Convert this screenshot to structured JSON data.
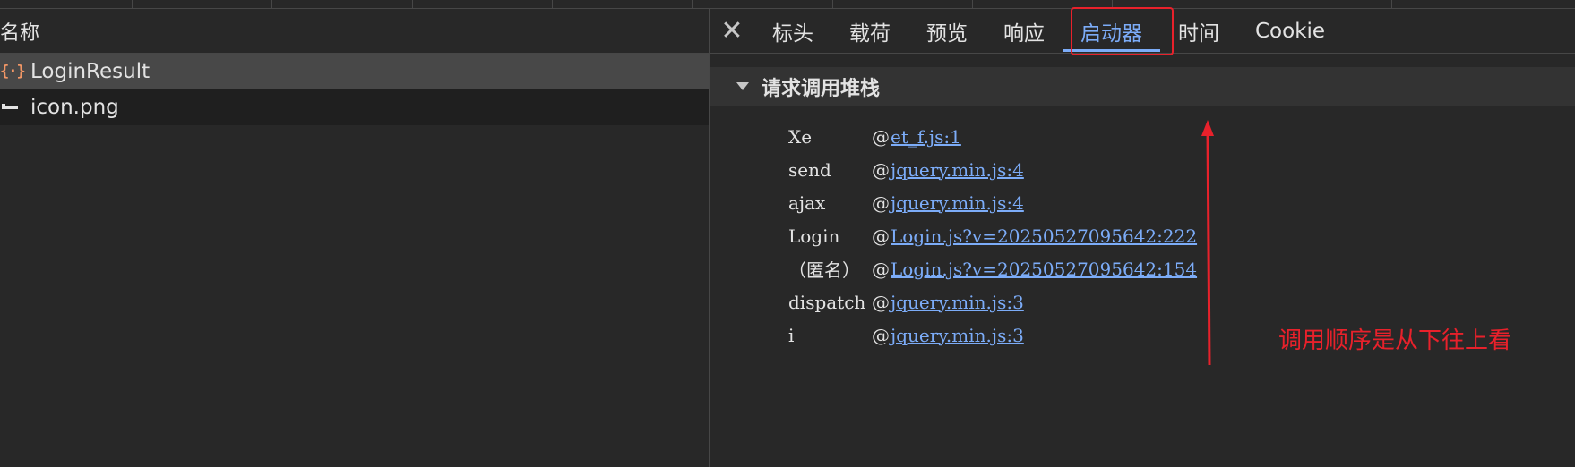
{
  "left_pane": {
    "header": "名称",
    "requests": [
      {
        "name": "LoginResult",
        "icon": "json-braces-icon",
        "selected": true
      },
      {
        "name": "icon.png",
        "icon": "image-line-icon",
        "selected": false
      }
    ]
  },
  "tabs": {
    "close_glyph": "✕",
    "items": [
      {
        "label": "标头",
        "active": false
      },
      {
        "label": "载荷",
        "active": false
      },
      {
        "label": "预览",
        "active": false
      },
      {
        "label": "响应",
        "active": false
      },
      {
        "label": "启动器",
        "active": true
      },
      {
        "label": "时间",
        "active": false
      },
      {
        "label": "Cookie",
        "active": false
      }
    ]
  },
  "initiator": {
    "section_title": "请求调用堆栈",
    "frames": [
      {
        "fn": "Xe",
        "at": "@",
        "link": "et_f.js:1"
      },
      {
        "fn": "send",
        "at": "@",
        "link": "jquery.min.js:4"
      },
      {
        "fn": "ajax",
        "at": "@",
        "link": "jquery.min.js:4"
      },
      {
        "fn": "Login",
        "at": "@",
        "link": "Login.js?v=20250527095642:222"
      },
      {
        "fn": "（匿名）",
        "at": "@",
        "link": "Login.js?v=20250527095642:154"
      },
      {
        "fn": "dispatch",
        "at": "@",
        "link": "jquery.min.js:3"
      },
      {
        "fn": "i",
        "at": "@",
        "link": "jquery.min.js:3"
      }
    ]
  },
  "annotation": {
    "text": "调用顺序是从下往上看",
    "color": "#e8212b"
  },
  "colors": {
    "accent": "#7cacf8",
    "json_icon": "#f29766",
    "background": "#282828"
  }
}
